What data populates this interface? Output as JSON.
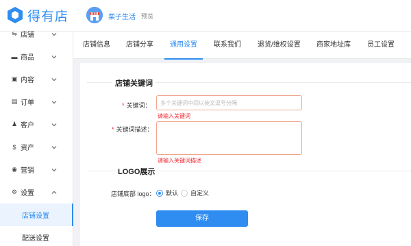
{
  "brand": {
    "name": "得有店"
  },
  "header": {
    "store_name": "栗子生活",
    "preview_label": "预览"
  },
  "sidebar": {
    "items": [
      {
        "label": "店铺",
        "icon": "shop-icon",
        "expanded": false
      },
      {
        "label": "商品",
        "icon": "goods-icon",
        "expanded": false
      },
      {
        "label": "内容",
        "icon": "content-icon",
        "expanded": false
      },
      {
        "label": "订单",
        "icon": "order-icon",
        "expanded": false
      },
      {
        "label": "客户",
        "icon": "customer-icon",
        "expanded": false
      },
      {
        "label": "资产",
        "icon": "asset-icon",
        "expanded": false
      },
      {
        "label": "营销",
        "icon": "marketing-icon",
        "expanded": false
      },
      {
        "label": "设置",
        "icon": "settings-icon",
        "expanded": true
      }
    ],
    "subitems": [
      {
        "label": "店铺设置",
        "active": true
      },
      {
        "label": "配送设置",
        "active": false
      }
    ]
  },
  "tabs": [
    {
      "label": "店铺信息",
      "active": false
    },
    {
      "label": "店铺分享",
      "active": false
    },
    {
      "label": "通用设置",
      "active": true
    },
    {
      "label": "联系我们",
      "active": false
    },
    {
      "label": "退货/维权设置",
      "active": false
    },
    {
      "label": "商家地址库",
      "active": false
    },
    {
      "label": "员工设置",
      "active": false
    }
  ],
  "keywords_section": {
    "title": "店铺关键词",
    "keyword": {
      "label": "关键词：",
      "placeholder": "多个关键词中间以英文逗号分隔",
      "value": "",
      "error": "请输入关键词"
    },
    "description": {
      "label": "关键词描述：",
      "value": "",
      "error": "请输入关键词描述"
    }
  },
  "logo_section": {
    "title": "LOGO展示",
    "label": "店铺底部 logo：",
    "options": [
      {
        "label": "默认",
        "checked": true
      },
      {
        "label": "自定义",
        "checked": false
      }
    ]
  },
  "actions": {
    "save_label": "保存"
  },
  "colors": {
    "accent": "#2f8cf0",
    "error": "#f5222d",
    "error_border": "#f0a58f",
    "background": "#f0f2f5"
  }
}
